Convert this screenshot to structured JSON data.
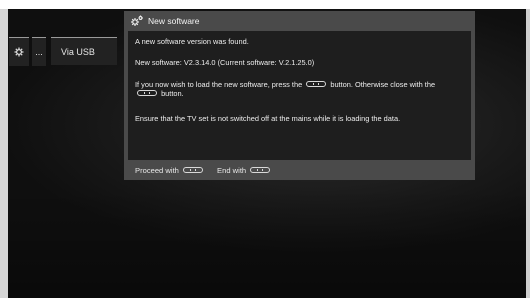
{
  "menu": {
    "settings_icon": "gear-icon",
    "more_label": "...",
    "usb_label": "Via USB"
  },
  "dialog": {
    "title_icon": "gears-icon",
    "title": "New software",
    "line1": "A new software version was found.",
    "line2": "New software:  V2.3.14.0   (Current software:  V.2.1.25.0)",
    "line3_part1": "If you now wish to load the new software, press the",
    "line3_part2": "button. Otherwise close with the",
    "line3_part3": "button.",
    "line4": "Ensure that the TV set is not switched off at the mains while it is loading the data.",
    "footer_proceed": "Proceed with",
    "footer_end": "End with",
    "ok_button_icon": "ok-button-icon",
    "exit_button_icon": "exit-button-icon"
  }
}
